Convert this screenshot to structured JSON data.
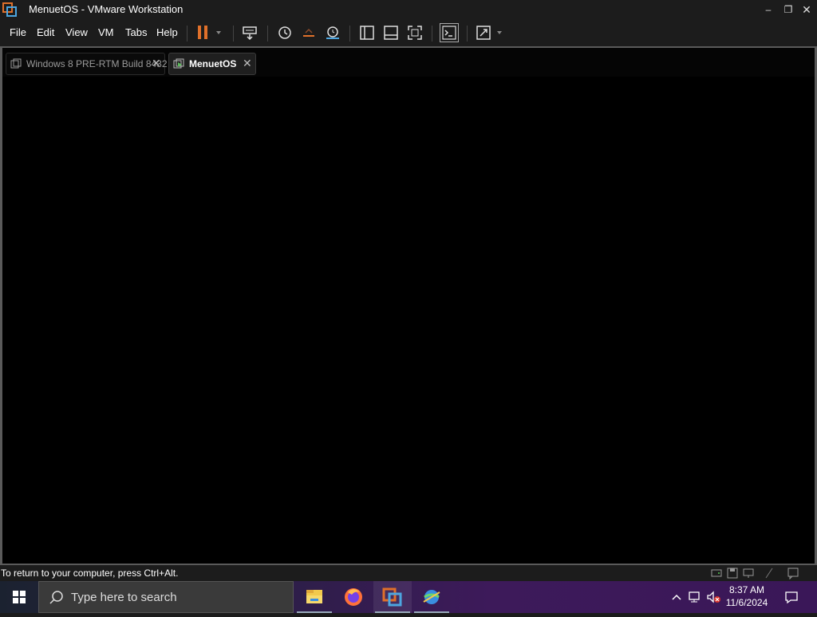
{
  "window": {
    "title": "MenuetOS - VMware Workstation"
  },
  "menu": {
    "file": "File",
    "edit": "Edit",
    "view": "View",
    "vm": "VM",
    "tabs": "Tabs",
    "help": "Help"
  },
  "tabs": [
    {
      "label": "Windows 8 PRE-RTM Build 8432",
      "active": false
    },
    {
      "label": "MenuetOS",
      "active": true
    }
  ],
  "status": {
    "message": "To return to your computer, press Ctrl+Alt."
  },
  "taskbar": {
    "search_placeholder": "Type here to search",
    "time": "8:37 AM",
    "date": "11/6/2024"
  },
  "colors": {
    "accent_orange": "#e0702a",
    "vm_screen": "#000000",
    "chrome": "#1c1c1c"
  },
  "icons": [
    "vmware-logo-icon",
    "pause-icon",
    "send-ctrl-alt-del-icon",
    "snapshot-icon",
    "revert-snapshot-icon",
    "snapshot-manager-icon",
    "library-icon",
    "thumbnail-icon",
    "fullscreen-icon",
    "console-icon",
    "stretch-icon",
    "windows-start-icon",
    "search-icon",
    "file-explorer-icon",
    "firefox-icon",
    "vmware-icon",
    "network-globe-icon"
  ]
}
